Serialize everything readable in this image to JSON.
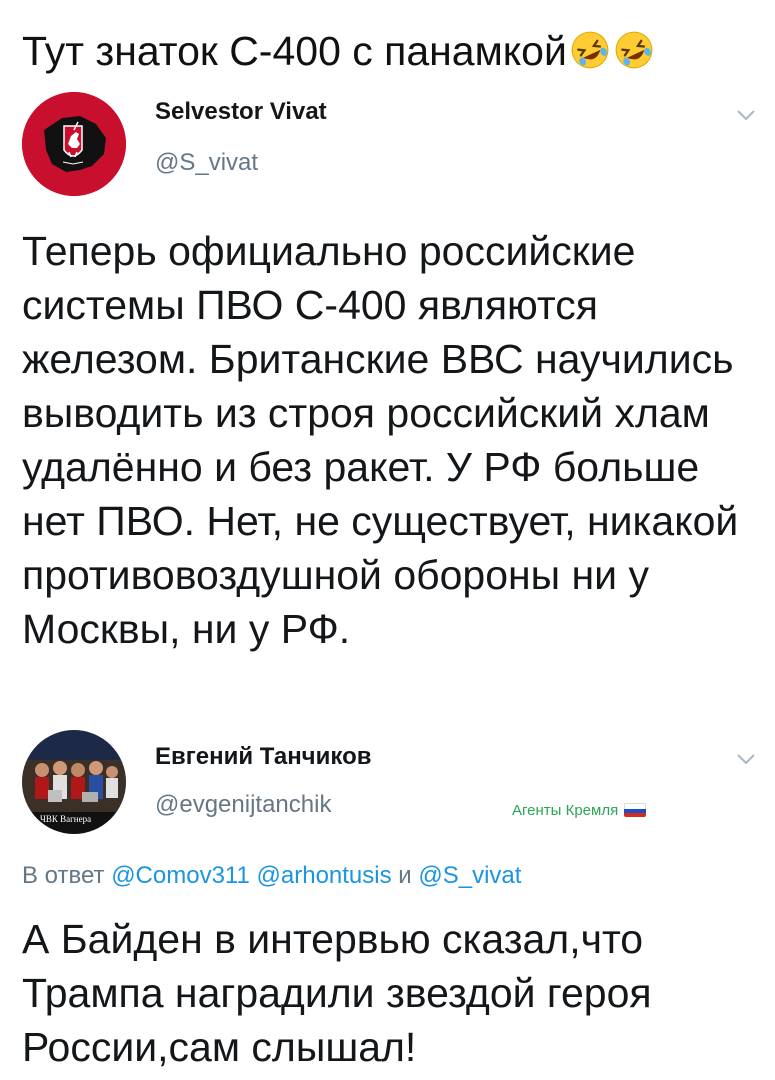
{
  "caption": {
    "text": "Тут знаток С-400 с панамкой",
    "emoji": [
      "rolling-on-floor-laughing-emoji",
      "rolling-on-floor-laughing-emoji"
    ]
  },
  "tweet1": {
    "display_name": "Selvestor Vivat",
    "handle": "@S_vivat",
    "avatar_icon": "belarus-pahonia-emblem-avatar",
    "text": "Теперь официально российские системы ПВО С-400 являются железом. Британские ВВС научились выводить из строя российский хлам удалённо и без ракет. У РФ больше нет ПВО. Нет, не существует, никакой противовоздушной обороны ни у Москвы, ни у РФ."
  },
  "tweet2": {
    "display_name": "Евгений Танчиков",
    "handle": "@evgenijtanchik",
    "avatar_icon": "wagner-group-group-photo-avatar",
    "avatar_caption": "ЧВК Вагнера",
    "badge": "Агенты Кремля",
    "badge_icon": "russian-flag-icon",
    "reply_prefix": "В ответ",
    "reply_mentions": [
      "@Comov311",
      "@arhontusis",
      "@S_vivat"
    ],
    "reply_and": "и",
    "text": "А Байден в интервью сказал,что Трампа наградили звездой героя России,сам слышал!"
  },
  "colors": {
    "text": "#14171a",
    "secondary": "#657786",
    "mention": "#1b95e0",
    "badge": "#2aa556",
    "avatar1_bg": "#c8102e"
  }
}
